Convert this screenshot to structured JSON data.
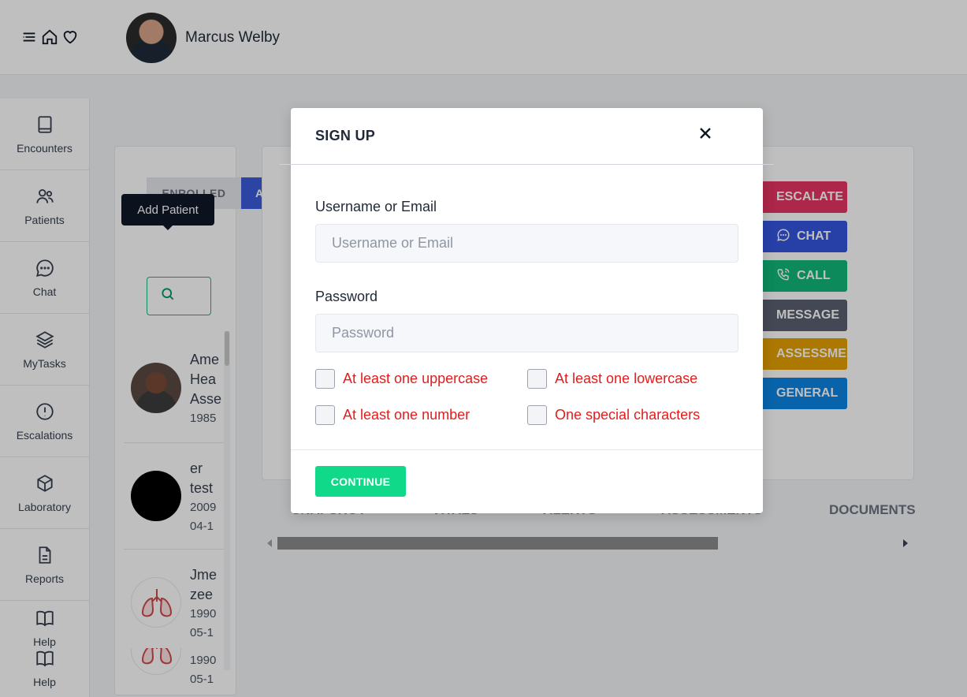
{
  "header": {
    "icons": [
      "menu-icon",
      "home-icon",
      "heart-icon"
    ],
    "user_name": "Marcus Welby"
  },
  "sidebar": {
    "items": [
      {
        "label": "Encounters",
        "icon": "book-icon"
      },
      {
        "label": "Patients",
        "icon": "users-icon"
      },
      {
        "label": "Chat",
        "icon": "chat-bubble-icon"
      },
      {
        "label": "MyTasks",
        "icon": "layers-icon"
      },
      {
        "label": "Escalations",
        "icon": "alert-circle-icon"
      },
      {
        "label": "Laboratory",
        "icon": "cube-icon"
      },
      {
        "label": "Reports",
        "icon": "document-icon"
      },
      {
        "label": "Help",
        "icon": "open-book-icon"
      },
      {
        "label": "Help",
        "icon": "open-book-icon"
      }
    ]
  },
  "patient_panel": {
    "tab_enrolled": "ENROLLED",
    "tab_active": "A",
    "tooltip": "Add Patient",
    "patients": [
      {
        "line1": "Ame",
        "line2": "Hea",
        "line3": "Asse",
        "line4": "1985"
      },
      {
        "line1": "er",
        "line2": "test",
        "line3": "2009",
        "line4": "04-1"
      },
      {
        "line1": "Jme",
        "line2": "zee",
        "line3": "1990",
        "line4": "05-1"
      },
      {
        "line1": "",
        "line2": "",
        "line3": "1990",
        "line4": "05-1"
      }
    ]
  },
  "actions": {
    "escalate": "ESCALATE",
    "chat": "CHAT",
    "call": "CALL",
    "message": "MESSAGE",
    "assessment": "ASSESSMENT",
    "general": "GENERAL",
    "colors": {
      "escalate": "#e63462",
      "chat": "#3356e0",
      "call": "#10b97a",
      "message": "#5b6070",
      "assessment": "#e6a100",
      "general": "#0b84e3"
    }
  },
  "bottom_tabs": [
    "SNAPSHOT",
    "VITALS",
    "ALERTS",
    "ASSESSMENTS",
    "DOCUMENTS"
  ],
  "modal": {
    "title": "SIGN UP",
    "username_label": "Username or Email",
    "username_placeholder": "Username or Email",
    "password_label": "Password",
    "password_placeholder": "Password",
    "rules": [
      "At least one uppercase",
      "At least one lowercase",
      "At least one number",
      "One special characters"
    ],
    "continue_label": "CONTINUE"
  }
}
